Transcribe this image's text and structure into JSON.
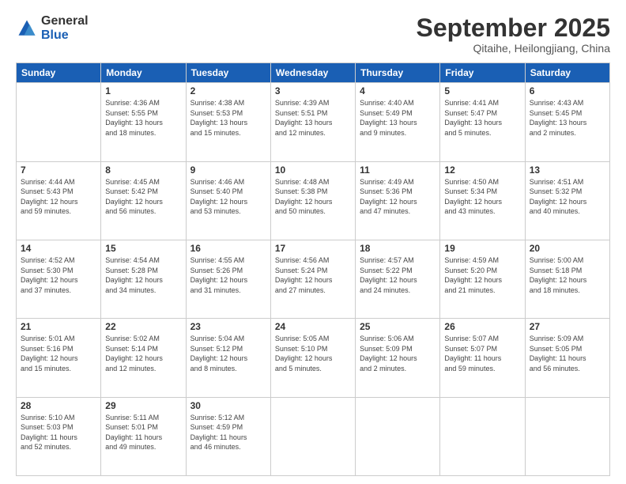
{
  "logo": {
    "general": "General",
    "blue": "Blue"
  },
  "header": {
    "month": "September 2025",
    "location": "Qitaihe, Heilongjiang, China"
  },
  "weekdays": [
    "Sunday",
    "Monday",
    "Tuesday",
    "Wednesday",
    "Thursday",
    "Friday",
    "Saturday"
  ],
  "weeks": [
    [
      {
        "day": null,
        "detail": null
      },
      {
        "day": "1",
        "detail": "Sunrise: 4:36 AM\nSunset: 5:55 PM\nDaylight: 13 hours\nand 18 minutes."
      },
      {
        "day": "2",
        "detail": "Sunrise: 4:38 AM\nSunset: 5:53 PM\nDaylight: 13 hours\nand 15 minutes."
      },
      {
        "day": "3",
        "detail": "Sunrise: 4:39 AM\nSunset: 5:51 PM\nDaylight: 13 hours\nand 12 minutes."
      },
      {
        "day": "4",
        "detail": "Sunrise: 4:40 AM\nSunset: 5:49 PM\nDaylight: 13 hours\nand 9 minutes."
      },
      {
        "day": "5",
        "detail": "Sunrise: 4:41 AM\nSunset: 5:47 PM\nDaylight: 13 hours\nand 5 minutes."
      },
      {
        "day": "6",
        "detail": "Sunrise: 4:43 AM\nSunset: 5:45 PM\nDaylight: 13 hours\nand 2 minutes."
      }
    ],
    [
      {
        "day": "7",
        "detail": "Sunrise: 4:44 AM\nSunset: 5:43 PM\nDaylight: 12 hours\nand 59 minutes."
      },
      {
        "day": "8",
        "detail": "Sunrise: 4:45 AM\nSunset: 5:42 PM\nDaylight: 12 hours\nand 56 minutes."
      },
      {
        "day": "9",
        "detail": "Sunrise: 4:46 AM\nSunset: 5:40 PM\nDaylight: 12 hours\nand 53 minutes."
      },
      {
        "day": "10",
        "detail": "Sunrise: 4:48 AM\nSunset: 5:38 PM\nDaylight: 12 hours\nand 50 minutes."
      },
      {
        "day": "11",
        "detail": "Sunrise: 4:49 AM\nSunset: 5:36 PM\nDaylight: 12 hours\nand 47 minutes."
      },
      {
        "day": "12",
        "detail": "Sunrise: 4:50 AM\nSunset: 5:34 PM\nDaylight: 12 hours\nand 43 minutes."
      },
      {
        "day": "13",
        "detail": "Sunrise: 4:51 AM\nSunset: 5:32 PM\nDaylight: 12 hours\nand 40 minutes."
      }
    ],
    [
      {
        "day": "14",
        "detail": "Sunrise: 4:52 AM\nSunset: 5:30 PM\nDaylight: 12 hours\nand 37 minutes."
      },
      {
        "day": "15",
        "detail": "Sunrise: 4:54 AM\nSunset: 5:28 PM\nDaylight: 12 hours\nand 34 minutes."
      },
      {
        "day": "16",
        "detail": "Sunrise: 4:55 AM\nSunset: 5:26 PM\nDaylight: 12 hours\nand 31 minutes."
      },
      {
        "day": "17",
        "detail": "Sunrise: 4:56 AM\nSunset: 5:24 PM\nDaylight: 12 hours\nand 27 minutes."
      },
      {
        "day": "18",
        "detail": "Sunrise: 4:57 AM\nSunset: 5:22 PM\nDaylight: 12 hours\nand 24 minutes."
      },
      {
        "day": "19",
        "detail": "Sunrise: 4:59 AM\nSunset: 5:20 PM\nDaylight: 12 hours\nand 21 minutes."
      },
      {
        "day": "20",
        "detail": "Sunrise: 5:00 AM\nSunset: 5:18 PM\nDaylight: 12 hours\nand 18 minutes."
      }
    ],
    [
      {
        "day": "21",
        "detail": "Sunrise: 5:01 AM\nSunset: 5:16 PM\nDaylight: 12 hours\nand 15 minutes."
      },
      {
        "day": "22",
        "detail": "Sunrise: 5:02 AM\nSunset: 5:14 PM\nDaylight: 12 hours\nand 12 minutes."
      },
      {
        "day": "23",
        "detail": "Sunrise: 5:04 AM\nSunset: 5:12 PM\nDaylight: 12 hours\nand 8 minutes."
      },
      {
        "day": "24",
        "detail": "Sunrise: 5:05 AM\nSunset: 5:10 PM\nDaylight: 12 hours\nand 5 minutes."
      },
      {
        "day": "25",
        "detail": "Sunrise: 5:06 AM\nSunset: 5:09 PM\nDaylight: 12 hours\nand 2 minutes."
      },
      {
        "day": "26",
        "detail": "Sunrise: 5:07 AM\nSunset: 5:07 PM\nDaylight: 11 hours\nand 59 minutes."
      },
      {
        "day": "27",
        "detail": "Sunrise: 5:09 AM\nSunset: 5:05 PM\nDaylight: 11 hours\nand 56 minutes."
      }
    ],
    [
      {
        "day": "28",
        "detail": "Sunrise: 5:10 AM\nSunset: 5:03 PM\nDaylight: 11 hours\nand 52 minutes."
      },
      {
        "day": "29",
        "detail": "Sunrise: 5:11 AM\nSunset: 5:01 PM\nDaylight: 11 hours\nand 49 minutes."
      },
      {
        "day": "30",
        "detail": "Sunrise: 5:12 AM\nSunset: 4:59 PM\nDaylight: 11 hours\nand 46 minutes."
      },
      {
        "day": null,
        "detail": null
      },
      {
        "day": null,
        "detail": null
      },
      {
        "day": null,
        "detail": null
      },
      {
        "day": null,
        "detail": null
      }
    ]
  ]
}
